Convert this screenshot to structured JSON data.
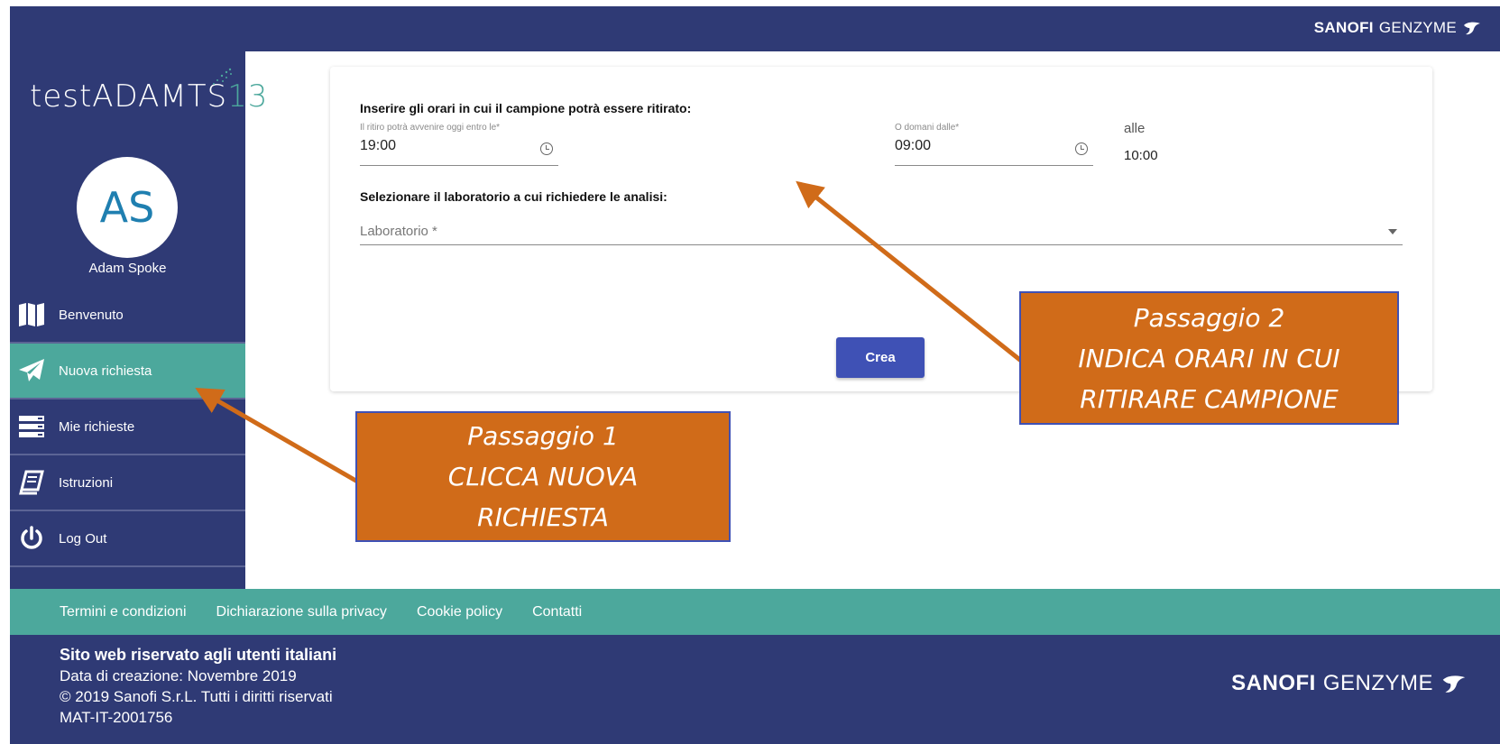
{
  "brand": {
    "bold": "SANOFI",
    "light": "GENZYME"
  },
  "logo": {
    "main": "testADAMTS",
    "suffix": "13"
  },
  "user": {
    "initials": "AS",
    "name": "Adam Spoke"
  },
  "nav": {
    "items": [
      {
        "label": "Benvenuto",
        "icon": "map-icon"
      },
      {
        "label": "Nuova richiesta",
        "icon": "paper-plane-icon",
        "active": true
      },
      {
        "label": "Mie richieste",
        "icon": "list-icon"
      },
      {
        "label": "Istruzioni",
        "icon": "book-icon"
      },
      {
        "label": "Log Out",
        "icon": "power-icon"
      }
    ]
  },
  "form": {
    "pickup_question": "Inserire gli orari in cui il campione potrà essere ritirato:",
    "today_label": "Il ritiro potrà avvenire oggi entro le*",
    "today_value": "19:00",
    "tomorrow_label": "O domani dalle*",
    "tomorrow_value": "09:00",
    "until_label": "alle",
    "until_value": "10:00",
    "lab_question": "Selezionare il laboratorio a cui richiedere le analisi:",
    "lab_placeholder": "Laboratorio *",
    "submit_label": "Crea"
  },
  "callouts": {
    "step1": {
      "title": "Passaggio 1",
      "line2": "CLICCA NUOVA",
      "line3": "RICHIESTA"
    },
    "step2": {
      "title": "Passaggio 2",
      "line2": "INDICA ORARI IN CUI",
      "line3": "RITIRARE CAMPIONE"
    }
  },
  "footer": {
    "links": [
      "Termini e condizioni",
      "Dichiarazione sulla privacy",
      "Cookie policy",
      "Contatti"
    ],
    "line1": "Sito web riservato agli utenti italiani",
    "line2": "Data di creazione: Novembre 2019",
    "line3": "© 2019 Sanofi S.r.L. Tutti i diritti riservati",
    "line4": "MAT-IT-2001756"
  },
  "colors": {
    "navy": "#2f3a75",
    "teal": "#4ca89c",
    "button": "#3f51b5",
    "callout": "#d06b19"
  }
}
